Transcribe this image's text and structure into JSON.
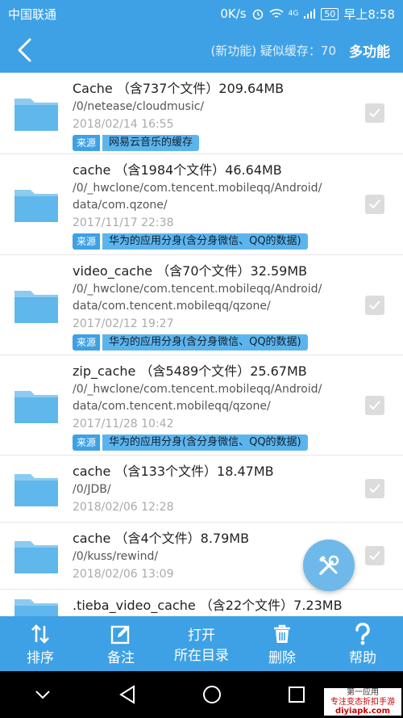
{
  "status": {
    "carrier": "中国联通",
    "speed": "0K/s",
    "signal_label": "4G",
    "battery": "50",
    "time": "早上8:58"
  },
  "header": {
    "title": "(新功能) 疑似缓存：70",
    "action": "多功能"
  },
  "items": [
    {
      "name": "Cache （含737个文件）209.64MB",
      "path1": "/0/netease/cloudmusic/",
      "path2": "",
      "date": "2018/02/14 16:55",
      "tag_key": "来源",
      "tag_val": "网易云音乐的缓存"
    },
    {
      "name": "cache （含1984个文件）46.64MB",
      "path1": "/0/_hwclone/com.tencent.mobileqq/Android/",
      "path2": "data/com.qzone/",
      "date": "2017/11/17 22:38",
      "tag_key": "来源",
      "tag_val": "华为的应用分身(含分身微信、QQ的数据)"
    },
    {
      "name": "video_cache （含70个文件）32.59MB",
      "path1": "/0/_hwclone/com.tencent.mobileqq/Android/",
      "path2": "data/com.tencent.mobileqq/qzone/",
      "date": "2017/02/12 19:27",
      "tag_key": "来源",
      "tag_val": "华为的应用分身(含分身微信、QQ的数据)"
    },
    {
      "name": "zip_cache （含5489个文件）25.67MB",
      "path1": "/0/_hwclone/com.tencent.mobileqq/Android/",
      "path2": "data/com.tencent.mobileqq/qzone/",
      "date": "2017/11/28 10:42",
      "tag_key": "来源",
      "tag_val": "华为的应用分身(含分身微信、QQ的数据)"
    },
    {
      "name": "cache （含133个文件）18.47MB",
      "path1": "/0/JDB/",
      "path2": "",
      "date": "2018/02/06 12:28",
      "tag_key": "",
      "tag_val": ""
    },
    {
      "name": "cache （含4个文件）8.79MB",
      "path1": "/0/kuss/rewind/",
      "path2": "",
      "date": "2018/02/06 13:09",
      "tag_key": "",
      "tag_val": ""
    },
    {
      "name": ".tieba_video_cache （含22个文件）7.23MB",
      "path1": "",
      "path2": "",
      "date": "",
      "tag_key": "",
      "tag_val": ""
    }
  ],
  "toolbar": {
    "sort": "排序",
    "note": "备注",
    "open_top": "打开",
    "open_bottom": "所在目录",
    "delete": "删除",
    "help": "帮助"
  },
  "watermark": {
    "line1": "第一应用",
    "line2": "专注变态折扣手游",
    "line3": "diyiapk.com"
  }
}
